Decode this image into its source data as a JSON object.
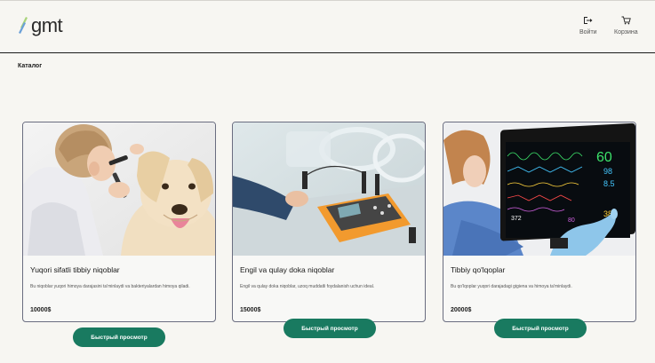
{
  "header": {
    "logo_text": "gmt",
    "login_label": "Войти",
    "cart_label": "Корзина"
  },
  "breadcrumb": "Каталог",
  "products": [
    {
      "title": "Yuqori sifatli tibbiy niqoblar",
      "description": "Bu niqoblar yuqori himoya darajasini ta'minlaydi va bakteriyalardan himoya qiladi.",
      "price": "10000$",
      "button": "Быстрый просмотр",
      "image": "doctor-examining-dog-ear"
    },
    {
      "title": "Engil va qulay doka niqoblar",
      "description": "Engil va qulay doka niqoblar, uzoq muddatli foydalanish uchun ideal.",
      "price": "15000$",
      "button": "Быстрый просмотр",
      "image": "lab-testing-equipment"
    },
    {
      "title": "Tibbiy qo'lqoplar",
      "description": "Bu qo'lqoplar yuqori darajadagi gigiena va himoya ta'minlaydi.",
      "price": "20000$",
      "button": "Быстрый просмотр",
      "image": "patient-monitor-screen"
    }
  ],
  "colors": {
    "accent": "#197a60",
    "background": "#f7f6f2",
    "card_border": "#6a6d80"
  },
  "monitor_readouts": [
    "60",
    "98",
    "8.5",
    "372",
    "80",
    "38"
  ]
}
